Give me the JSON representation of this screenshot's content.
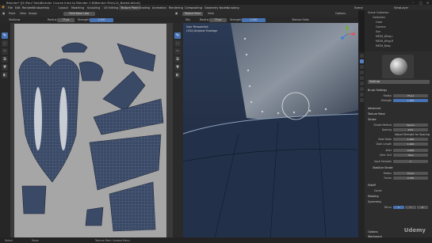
{
  "window": {
    "title": "Blender* [D:\\Paul Tuts\\Blender Course Intro to Blender 2.8\\Blender Files\\14_Baked.blend]"
  },
  "menu": [
    "File",
    "Edit",
    "Render",
    "Window",
    "Help"
  ],
  "workspaces": [
    "Layout",
    "Modeling",
    "Sculpting",
    "UV Editing",
    "Texture Paint",
    "Shading",
    "Animation",
    "Rendering",
    "Compositing",
    "Geometry Nodes",
    "Scripting"
  ],
  "active_workspace": "Texture Paint",
  "top_right": {
    "scene": "Scene",
    "view_layer": "ViewLayer"
  },
  "image_editor": {
    "header": {
      "mode": "Paint",
      "view": "View",
      "image": "Image",
      "image_name": "Paint Base Color"
    },
    "tool_header": {
      "brush": "TexDraw",
      "radius_label": "Radius",
      "radius_value": "75 px",
      "strength_label": "Strength",
      "strength_value": "1.000"
    }
  },
  "viewport": {
    "header": {
      "mode": "Texture Paint",
      "view": "View",
      "blend": "Mix",
      "radius_label": "Radius",
      "radius_value": "75 px",
      "strength_label": "Strength",
      "strength_value": "1.000",
      "texture_slot": "Texture Slots",
      "options": "Options"
    },
    "overlay": {
      "line1": "User Perspective",
      "line2": "(150) Airplane Fuselage"
    }
  },
  "outliner": {
    "items": [
      "Scene Collection",
      "Collection",
      "Cube",
      "Camera",
      "Sun",
      "MESH_Wing.L",
      "MESH_Wing.R",
      "MESH_Body"
    ]
  },
  "properties": {
    "brush_name": "TexDraw",
    "sections": {
      "brush_settings": "Brush Settings",
      "radius_label": "Radius",
      "radius_value": "75 px",
      "strength_label": "Strength",
      "strength_value": "1.000",
      "advanced": "Advanced",
      "texture_mask": "Texture Mask",
      "stroke": "Stroke",
      "stroke_method_label": "Stroke Method",
      "stroke_method_value": "Space",
      "spacing_label": "Spacing",
      "spacing_value": "10%",
      "adjust": "Adjust Strength for Spacing",
      "dash_ratio_label": "Dash Ratio",
      "dash_ratio_value": "1.000",
      "dash_length_label": "Dash Length",
      "dash_length_value": "1.000",
      "jitter_label": "Jitter",
      "jitter_value": "0.000",
      "jitter_unit_label": "Jitter Unit",
      "jitter_unit_value": "View",
      "input_samples_label": "Input Samples",
      "input_samples_value": "1",
      "stabilize": "Stabilize Stroke",
      "radius2_label": "Radius",
      "radius2_value": "10 px",
      "factor_label": "Factor",
      "factor_value": "0.750",
      "falloff": "Falloff",
      "curve": "Curve",
      "masking": "Masking",
      "symmetry": "Symmetry",
      "mirror_label": "Mirror",
      "axis_x": "X",
      "axis_y": "Y",
      "axis_z": "Z",
      "options": "Options",
      "workspace": "Workspace"
    }
  },
  "status": {
    "select": "Select",
    "move": "Move",
    "menu": "Texture Paint Context Menu"
  },
  "watermark": "Udemy"
}
